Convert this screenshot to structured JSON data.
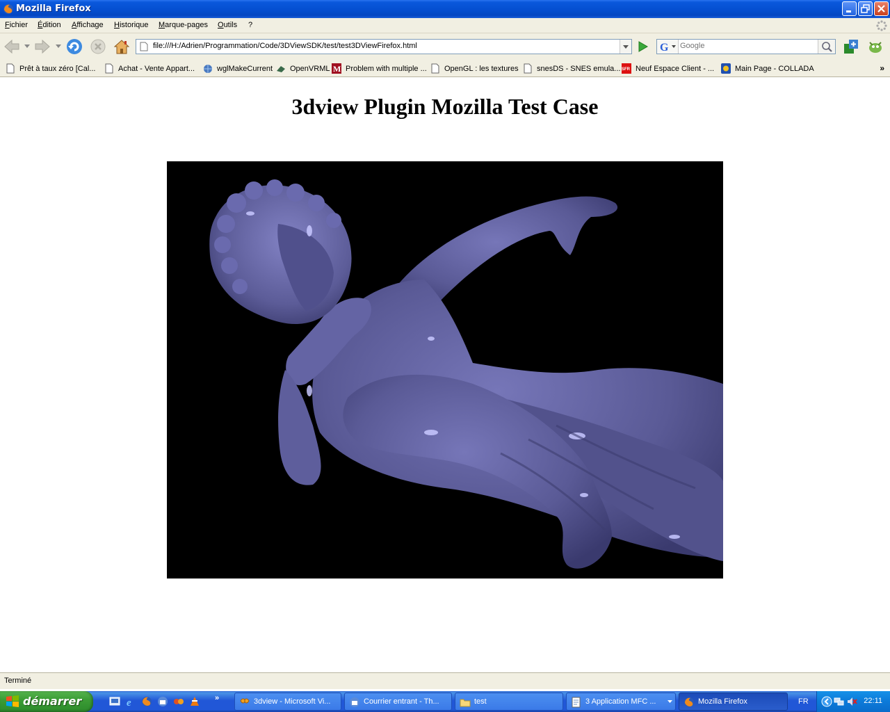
{
  "window": {
    "title": "Mozilla Firefox"
  },
  "menu": [
    "Fichier",
    "Édition",
    "Affichage",
    "Historique",
    "Marque-pages",
    "Outils",
    "?"
  ],
  "nav": {
    "url": "file:///H:/Adrien/Programmation/Code/3DViewSDK/test/test3DViewFirefox.html",
    "search_placeholder": "Google"
  },
  "bookmarks": [
    {
      "label": "Prêt à taux zéro [Cal...",
      "icon": "page-icon"
    },
    {
      "label": "Achat - Vente Appart...",
      "icon": "page-icon"
    },
    {
      "label": "wglMakeCurrent",
      "icon": "globe-icon"
    },
    {
      "label": "OpenVRML",
      "icon": "openvrml-icon"
    },
    {
      "label": "Problem with multiple ...",
      "icon": "m-icon"
    },
    {
      "label": "OpenGL : les textures",
      "icon": "page-icon"
    },
    {
      "label": "snesDS - SNES emula...",
      "icon": "page-icon"
    },
    {
      "label": "Neuf Espace Client - ...",
      "icon": "sfr-icon"
    },
    {
      "label": "Main Page - COLLADA",
      "icon": "collada-icon"
    }
  ],
  "content": {
    "heading": "3dview Plugin Mozilla Test Case"
  },
  "status": {
    "text": "Terminé"
  },
  "taskbar": {
    "start_label": "démarrer",
    "tasks": [
      {
        "label": "3dview - Microsoft Vi...",
        "active": false
      },
      {
        "label": "Courrier entrant - Th...",
        "active": false
      },
      {
        "label": "test",
        "active": false
      },
      {
        "label": "3 Application MFC ...",
        "active": false
      },
      {
        "label": "Mozilla Firefox",
        "active": true
      }
    ],
    "language": "FR",
    "clock": "22:11"
  },
  "colors": {
    "titlebar": "#0550d2",
    "chrome": "#f1efe2",
    "statue": "#5a5a96",
    "start": "#3c9d36"
  }
}
